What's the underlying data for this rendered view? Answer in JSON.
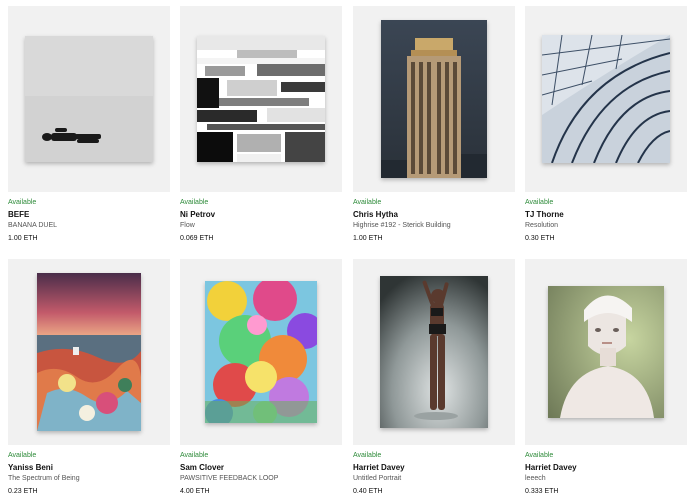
{
  "gallery": {
    "items": [
      {
        "status": "Available",
        "artist": "BEFE",
        "title": "BANANA DUEL",
        "price": "1.00 ETH",
        "artwork": "figure-on-grey-artwork"
      },
      {
        "status": "Available",
        "artist": "Ni Petrov",
        "title": "Flow",
        "price": "0.069 ETH",
        "artwork": "glitch-bw-artwork"
      },
      {
        "status": "Available",
        "artist": "Chris Hytha",
        "title": "Highrise #192 - Sterick Building",
        "price": "1.00 ETH",
        "artwork": "highrise-building-artwork"
      },
      {
        "status": "Available",
        "artist": "TJ Thorne",
        "title": "Resolution",
        "price": "0.30 ETH",
        "artwork": "glass-architecture-artwork"
      },
      {
        "status": "Available",
        "artist": "Yaniss Beni",
        "title": "The Spectrum of Being",
        "price": "0.23 ETH",
        "artwork": "sunset-paint-artwork"
      },
      {
        "status": "Available",
        "artist": "Sam Clover",
        "title": "PAWSITIVE FEEDBACK LOOP",
        "price": "4.00 ETH",
        "artwork": "psychedelic-collage-artwork"
      },
      {
        "status": "Available",
        "artist": "Harriet Davey",
        "title": "Untitled Portrait",
        "price": "0.40 ETH",
        "artwork": "dancer-figure-artwork"
      },
      {
        "status": "Available",
        "artist": "Harriet Davey",
        "title": "leeech",
        "price": "0.333 ETH",
        "artwork": "portrait-figure-artwork"
      }
    ]
  }
}
